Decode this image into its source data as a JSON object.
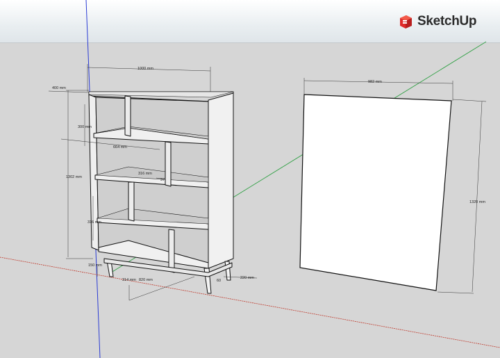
{
  "app": {
    "name": "SketchUp",
    "logo_icon": "sketchup-logo-icon"
  },
  "colors": {
    "sky": "#eef2f4",
    "ground": "#d6d6d6",
    "axis_red": "#c0392b",
    "axis_green": "#2ea043",
    "axis_blue": "#2a3bd4",
    "logo_red": "#e02a2a",
    "face_light": "#f4f4f4",
    "face_shade": "#cfcfcf"
  },
  "dimensions": {
    "width_top": "1000 mm",
    "depth_top": "400 mm",
    "shelf_height": "300 mm",
    "shelf_width": "664 mm",
    "compartment_depth": "316 mm",
    "compartment_height": "316 mm",
    "compartment_small": "37",
    "total_height": "1302 mm",
    "base_height": "150 mm",
    "base_side": "314 mm",
    "base_width": "820 mm",
    "leg_depth": "220 mm",
    "leg_offset": "60",
    "panel_width": "982 mm",
    "panel_height": "1320 mm"
  }
}
